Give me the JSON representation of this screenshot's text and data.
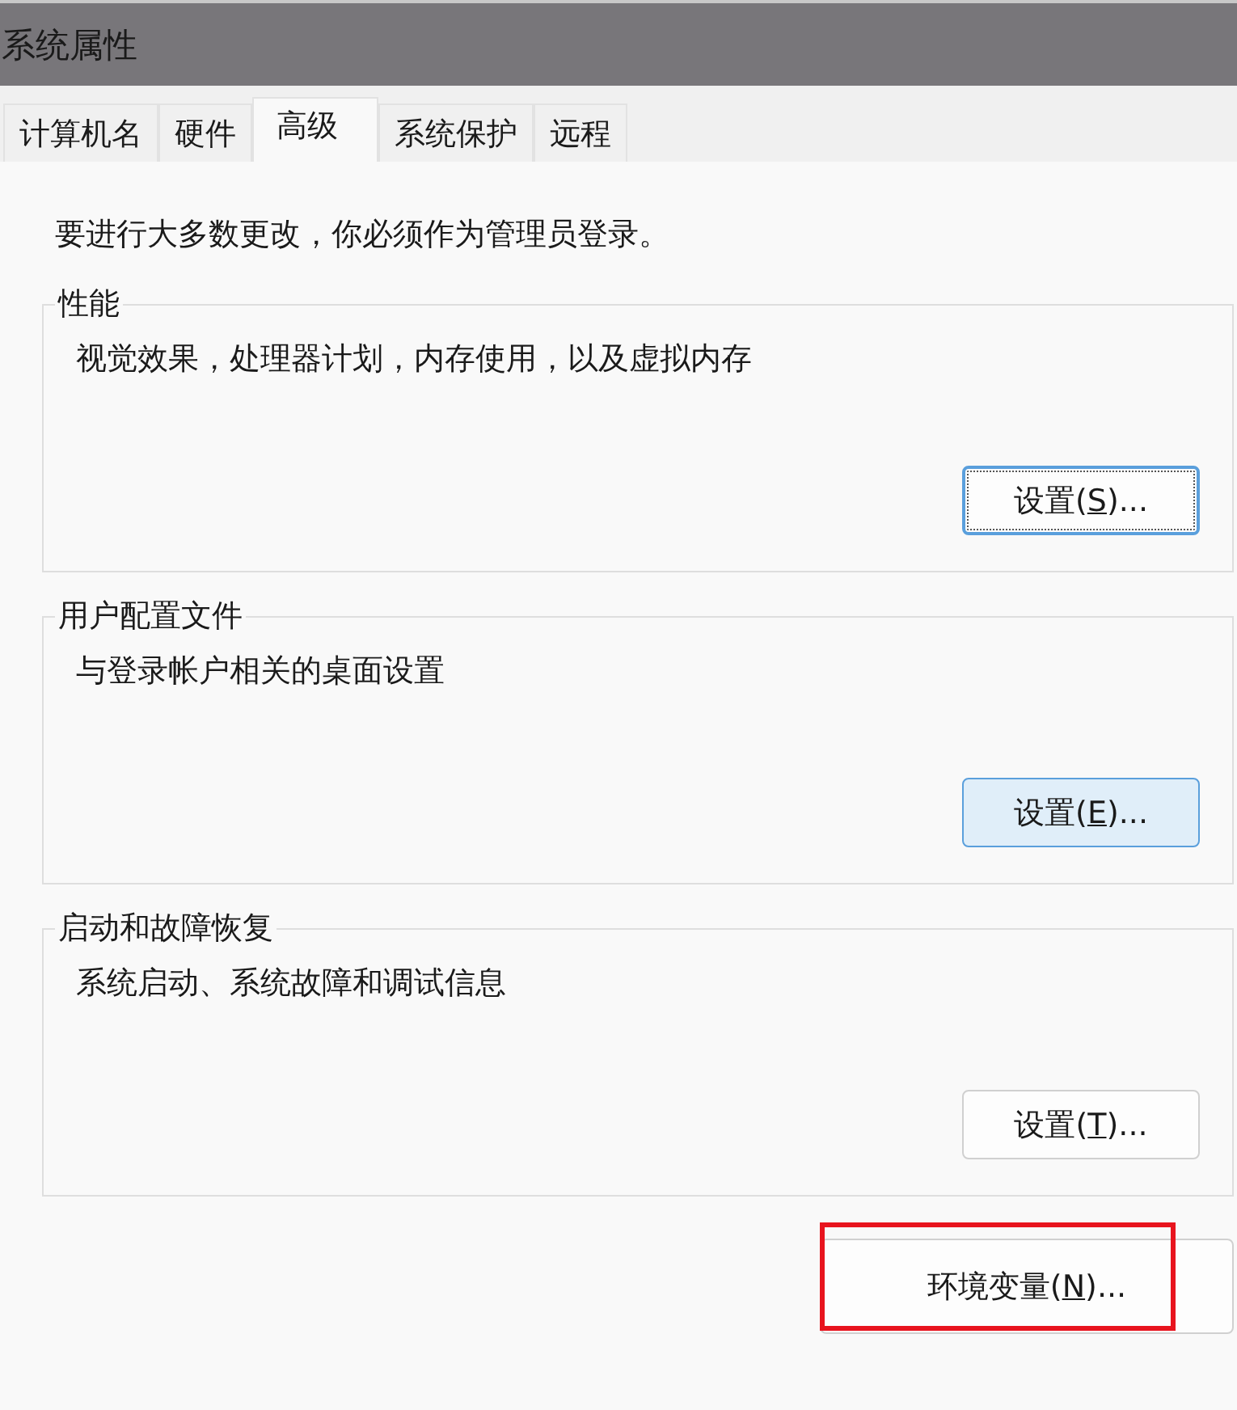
{
  "window": {
    "title": "系统属性"
  },
  "tabs": [
    {
      "label": "计算机名",
      "selected": false
    },
    {
      "label": "硬件",
      "selected": false
    },
    {
      "label": "高级",
      "selected": true
    },
    {
      "label": "系统保护",
      "selected": false
    },
    {
      "label": "远程",
      "selected": false
    }
  ],
  "notice": "要进行大多数更改，你必须作为管理员登录。",
  "groups": [
    {
      "legend": "性能",
      "description": "视觉效果，处理器计划，内存使用，以及虚拟内存",
      "button": {
        "text_before": "设置(",
        "access_key": "S",
        "text_after": ")...",
        "focused": true,
        "hovered": false
      }
    },
    {
      "legend": "用户配置文件",
      "description": "与登录帐户相关的桌面设置",
      "button": {
        "text_before": "设置(",
        "access_key": "E",
        "text_after": ")...",
        "focused": false,
        "hovered": true
      }
    },
    {
      "legend": "启动和故障恢复",
      "description": "系统启动、系统故障和调试信息",
      "button": {
        "text_before": "设置(",
        "access_key": "T",
        "text_after": ")...",
        "focused": false,
        "hovered": false
      }
    }
  ],
  "env_button": {
    "text_before": "环境变量(",
    "access_key": "N",
    "text_after": ")...",
    "highlighted": true
  }
}
